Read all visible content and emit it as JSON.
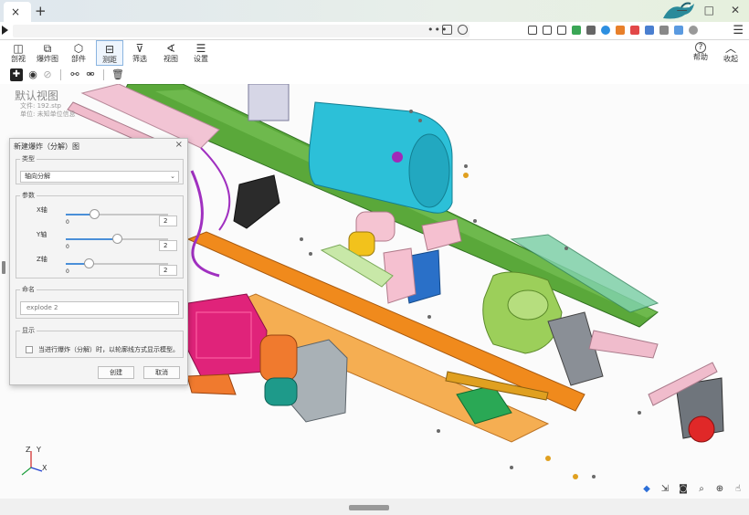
{
  "browser": {
    "tab_close": "×",
    "new_tab": "+",
    "address_ellipsis": "•••",
    "window_controls": [
      "—",
      "□",
      "✕"
    ],
    "menu": "☰"
  },
  "toolbar": {
    "items": [
      {
        "label": "剖视",
        "icon": "section-icon",
        "glyph": "◫"
      },
      {
        "label": "爆炸图",
        "icon": "explode-icon",
        "glyph": "⧉"
      },
      {
        "label": "部件",
        "icon": "cube-icon",
        "glyph": "⬡"
      },
      {
        "label": "测距",
        "icon": "ruler-icon",
        "glyph": "⊟"
      },
      {
        "label": "筛选",
        "icon": "filter-icon",
        "glyph": "⊽"
      },
      {
        "label": "视图",
        "icon": "view-icon",
        "glyph": "∢"
      },
      {
        "label": "设置",
        "icon": "settings-icon",
        "glyph": "☰"
      }
    ],
    "help_label": "帮助",
    "help_glyph": "?",
    "collapse_label": "收起",
    "collapse_glyph": "︿"
  },
  "subtoolbar": {
    "add": "✚",
    "eye": "◉",
    "hide": "⊘",
    "link": "⚯",
    "unlink": "⚮",
    "delete": "🗑"
  },
  "viewport": {
    "title": "默认视图",
    "file_line": "文件: 192.stp",
    "unit_line": "单位: 未知单位信息",
    "axis_x": "X",
    "axis_y": "Y",
    "axis_z": "Z"
  },
  "view_controls": [
    "◆",
    "⇲",
    "◙",
    "⌕",
    "⊕",
    "☝"
  ],
  "dialog": {
    "title": "新建爆炸（分解）图",
    "close": "×",
    "type_legend": "类型",
    "type_value": "轴向分解",
    "caret": "⌄",
    "params_legend": "参数",
    "axes": [
      {
        "name": "X轴",
        "min": "0",
        "value": "2",
        "fraction": 0.28
      },
      {
        "name": "Y轴",
        "min": "0",
        "value": "2",
        "fraction": 0.5
      },
      {
        "name": "Z轴",
        "min": "0",
        "value": "2",
        "fraction": 0.22
      }
    ],
    "name_legend": "命名",
    "name_value": "explode 2",
    "display_legend": "显示",
    "display_checkbox": "当进行爆炸（分解）时，以轮廓线方式显示模型。",
    "create_button": "创建",
    "cancel_button": "取消"
  },
  "colors": {
    "accent": "#4a8fd8",
    "frame_green": "#5aa83a",
    "frame_orange": "#f08a1c",
    "tank_cyan": "#2cc0d8",
    "engine_magenta": "#e0237a",
    "fifth_wheel": "#9ccf5a"
  }
}
